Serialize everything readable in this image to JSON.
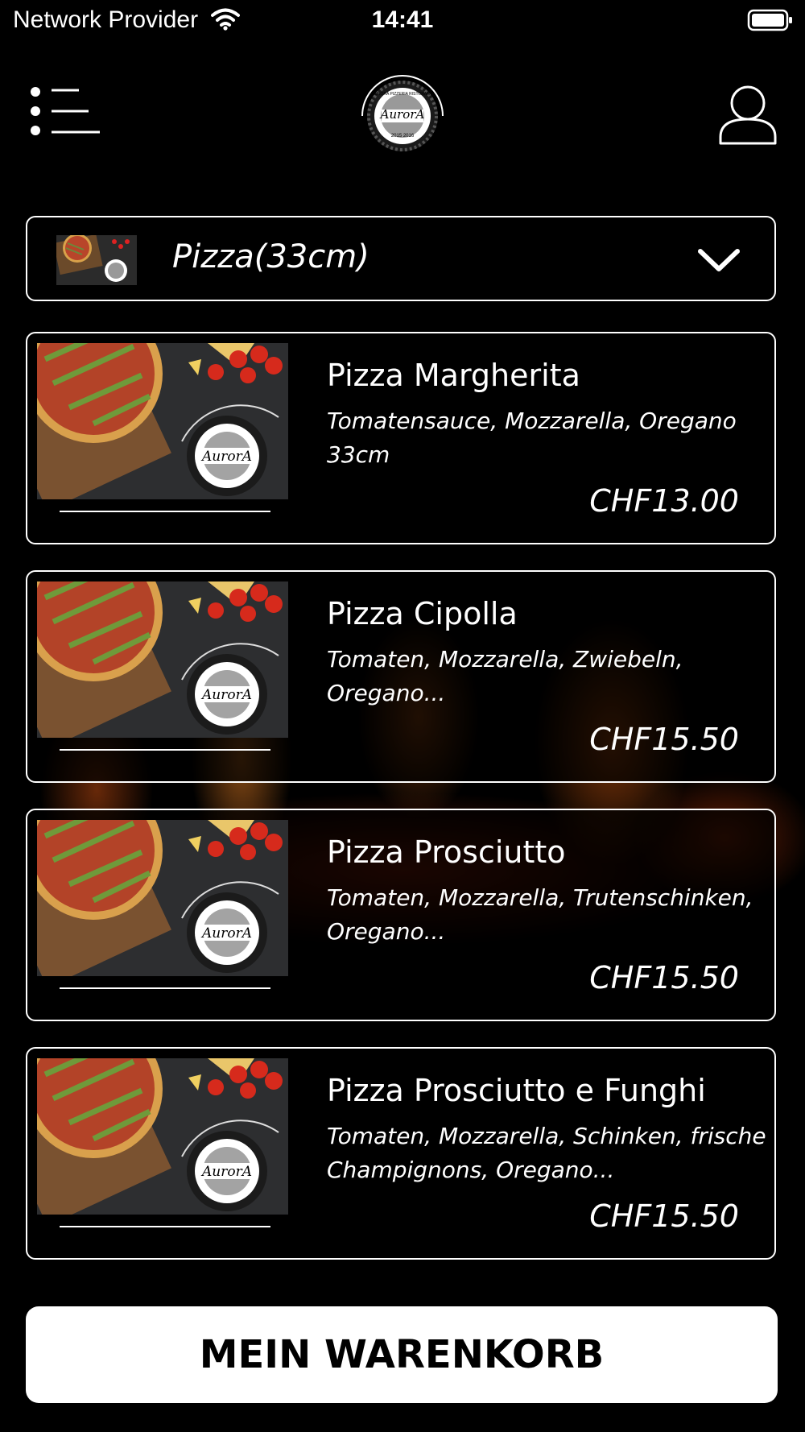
{
  "status_bar": {
    "carrier": "Network Provider",
    "time": "14:41",
    "icons": [
      "wifi-icon",
      "battery-icon"
    ]
  },
  "header": {
    "menu_icon": "menu-icon",
    "logo_text": "AurorA",
    "logo_ring_text": "AURORA PIZZERIA RISTORANTE",
    "logo_years": "2015 2016",
    "user_icon": "user-icon"
  },
  "category": {
    "label": "Pizza(33cm)",
    "icon": "chevron-down-icon"
  },
  "products": [
    {
      "name": "Pizza Margherita",
      "description": "Tomatensauce, Mozzarella, Oregano 33cm",
      "price": "CHF13.00"
    },
    {
      "name": "Pizza Cipolla",
      "description": "Tomaten, Mozzarella, Zwiebeln, Oregano...",
      "price": "CHF15.50"
    },
    {
      "name": "Pizza Prosciutto",
      "description": "Tomaten, Mozzarella, Trutenschinken, Oregano...",
      "price": "CHF15.50"
    },
    {
      "name": "Pizza Prosciutto e Funghi",
      "description": "Tomaten, Mozzarella, Schinken, frische Champignons, Oregano...",
      "price": "CHF15.50"
    }
  ],
  "cart": {
    "label": "MEIN WARENKORB"
  },
  "colors": {
    "background": "#000000",
    "text": "#ffffff",
    "button_background": "#ffffff",
    "button_text": "#000000"
  }
}
